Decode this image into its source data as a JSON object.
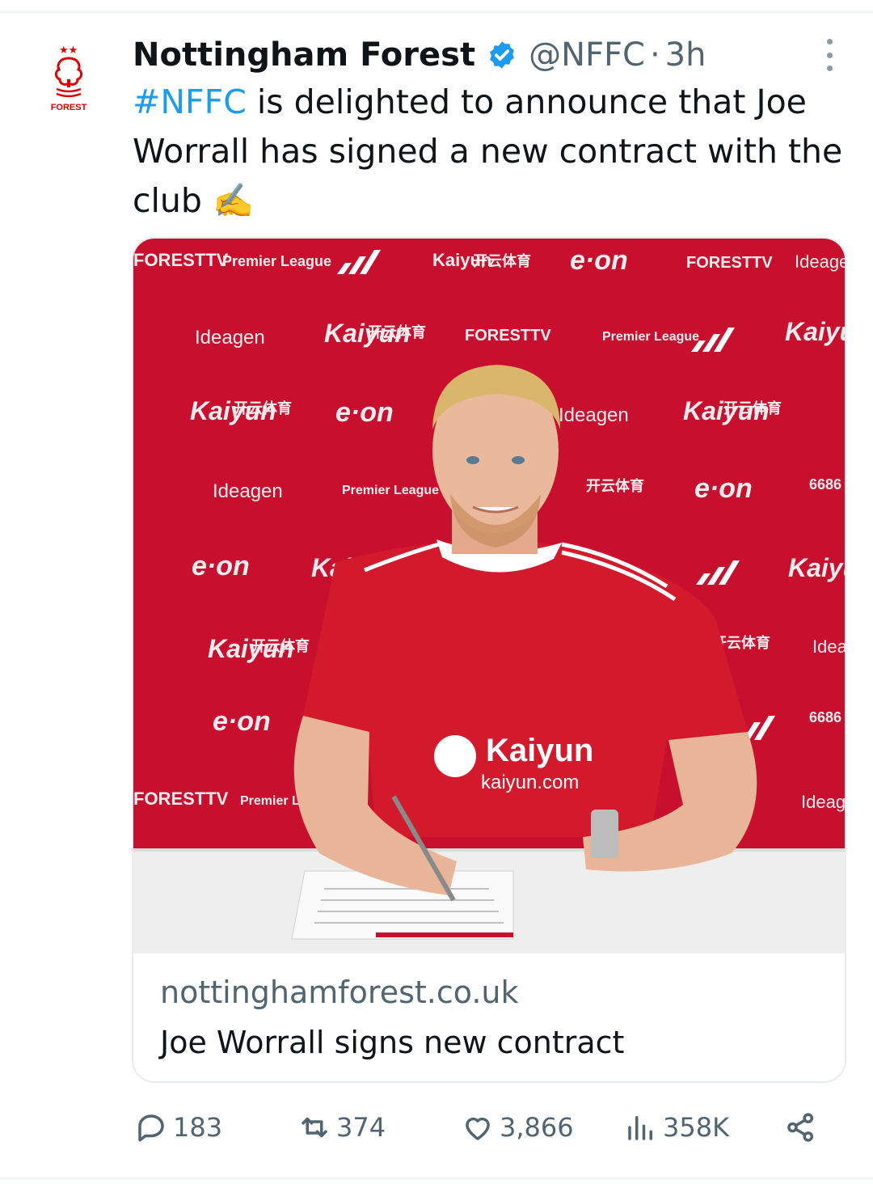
{
  "tweet": {
    "author_name": "Nottingham Forest",
    "handle": "@NFFC",
    "separator": "·",
    "age": "3h",
    "hashtag": "#NFFC",
    "text": " is delighted to announce that Joe Worrall has signed a new contract with the club ",
    "emoji": "✍️",
    "logo_text": "FOREST"
  },
  "card": {
    "domain": "nottinghamforest.co.uk",
    "title": "Joe Worrall signs new contract",
    "backdrop_sponsors": [
      "Premier League",
      "e·on",
      "Ideagen",
      "FORESTTV",
      "Kaiyun",
      "开云体育",
      "kaiyun.com",
      "6686"
    ],
    "shirt_sponsor": "Kaiyun",
    "shirt_sponsor_url": "kaiyun.com",
    "photo_description_colors": {
      "backdrop": "#c8102e",
      "shirt": "#d21a2c",
      "table": "#eeeeee"
    }
  },
  "actions": {
    "replies": "183",
    "reposts": "374",
    "likes": "3,866",
    "views": "358K"
  },
  "colors": {
    "link": "#1d9bf0",
    "muted": "#536471",
    "text": "#0f1419",
    "forest_red": "#dd0000"
  },
  "icons": [
    "forest-crest-icon",
    "verified-badge-icon",
    "more-options-icon",
    "reply-icon",
    "repost-icon",
    "like-icon",
    "views-icon",
    "share-icon"
  ]
}
